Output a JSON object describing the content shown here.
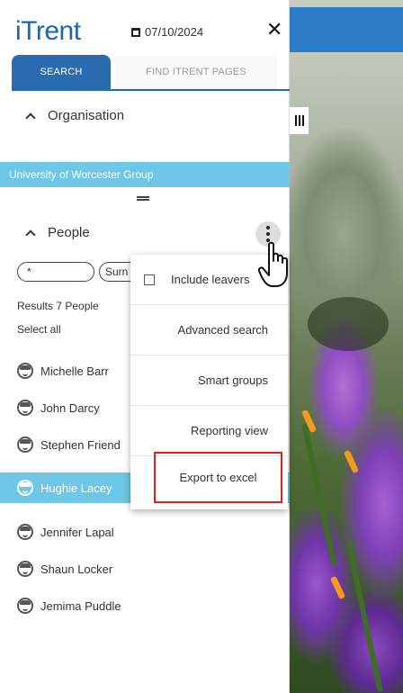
{
  "header": {
    "logo": "iTrent",
    "date": "07/10/2024",
    "close_symbol": "✕"
  },
  "tabs": [
    {
      "label": "SEARCH",
      "active": true
    },
    {
      "label": "FIND ITRENT PAGES",
      "active": false
    }
  ],
  "organisation": {
    "heading": "Organisation",
    "selected": "University of Worcester Group"
  },
  "people": {
    "heading": "People",
    "filter_text": "*",
    "filter_partial": "Surn",
    "results_text": "Results 7 People",
    "select_all": "Select all",
    "list": [
      {
        "name": "Michelle Barr",
        "selected": false
      },
      {
        "name": "John Darcy",
        "selected": false
      },
      {
        "name": "Stephen Friend",
        "selected": false
      },
      {
        "name": "Hughie Lacey",
        "selected": true
      },
      {
        "name": "Jennifer Lapal",
        "selected": false
      },
      {
        "name": "Shaun Locker",
        "selected": false
      },
      {
        "name": "Jemima Puddle",
        "selected": false
      }
    ]
  },
  "menu": {
    "include_leavers": "Include leavers",
    "include_leavers_checked": false,
    "items": [
      "Advanced search",
      "Smart groups",
      "Reporting view"
    ],
    "export": "Export to excel"
  },
  "colors": {
    "brand_blue": "#2b6cb0",
    "highlight": "#6ec7e6",
    "export_outline": "#e01e1e"
  }
}
